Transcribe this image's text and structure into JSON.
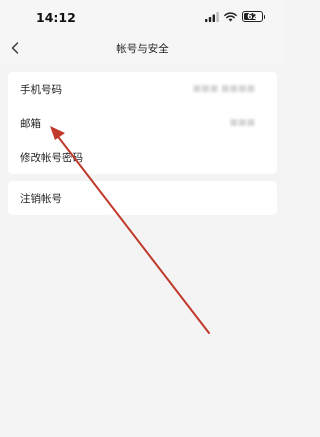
{
  "status_bar": {
    "time": "14:12",
    "battery_level": "62",
    "icons": [
      "signal-icon",
      "wifi-icon",
      "battery-icon"
    ]
  },
  "nav": {
    "back_icon": "chevron-left-icon",
    "title": "帐号与安全"
  },
  "account_group": {
    "items": [
      {
        "label": "手机号码"
      },
      {
        "label": "邮箱"
      },
      {
        "label": "修改帐号密码"
      }
    ]
  },
  "danger_group": {
    "items": [
      {
        "label": "注销帐号"
      }
    ]
  },
  "annotation": {
    "type": "arrow",
    "color": "#c0392b",
    "target": "邮箱"
  }
}
